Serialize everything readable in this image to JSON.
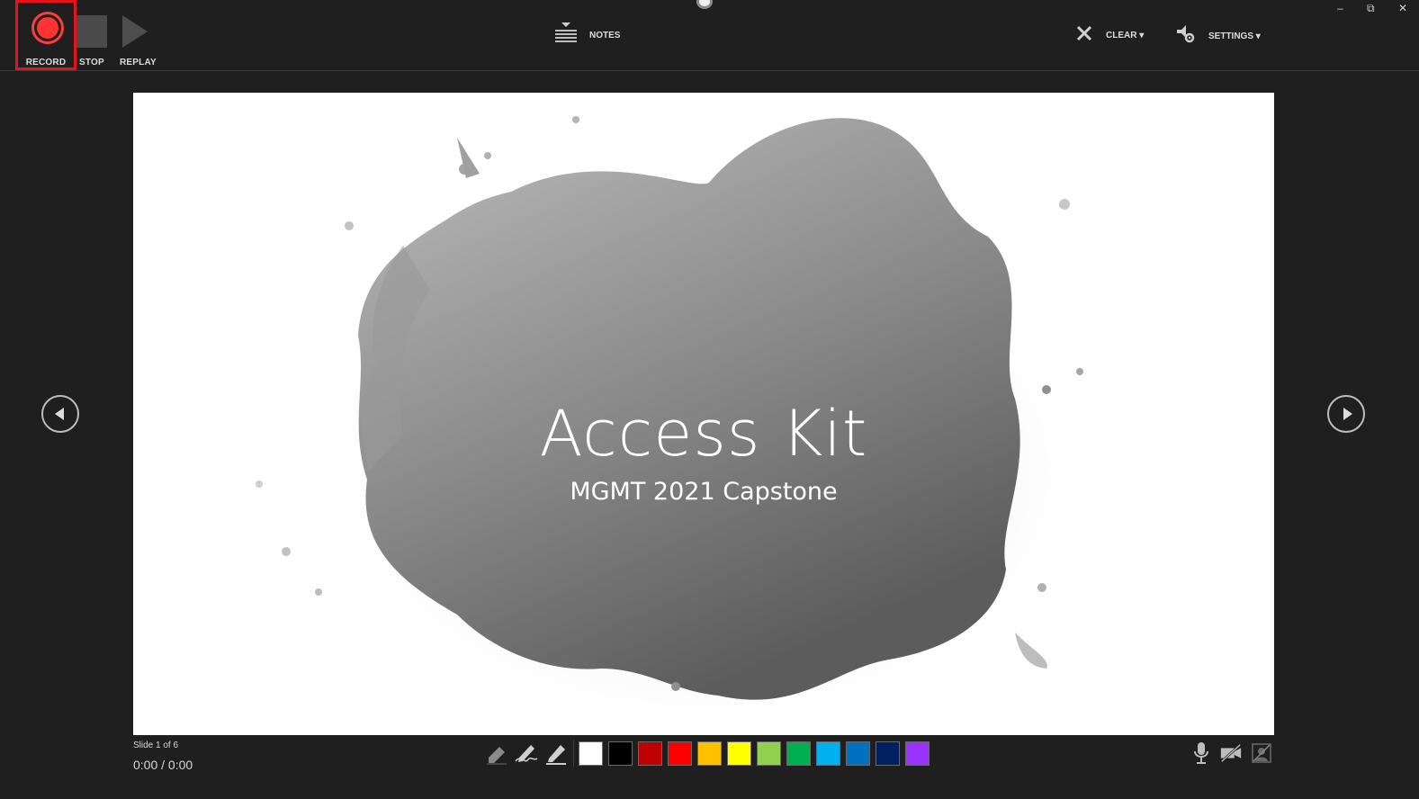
{
  "toolbar": {
    "record_label": "RECORD",
    "stop_label": "STOP",
    "replay_label": "REPLAY",
    "notes_label": "NOTES",
    "clear_label": "CLEAR ▾",
    "settings_label": "SETTINGS ▾",
    "icons": [
      "record-icon",
      "stop-icon",
      "replay-icon",
      "notes-icon",
      "clear-x-icon",
      "settings-icon"
    ]
  },
  "window_controls": {
    "minimize": "–",
    "restore": "⧉",
    "close": "✕"
  },
  "slide": {
    "title": "Access Kit",
    "subtitle": "MGMT 2021 Capstone"
  },
  "status": {
    "slide_count": "Slide 1 of 6",
    "timer": "0:00 / 0:00"
  },
  "ink_tools": [
    "eraser-icon",
    "pen-icon",
    "highlighter-icon"
  ],
  "colors": [
    "#ffffff",
    "#000000",
    "#c00000",
    "#ff0000",
    "#ffc000",
    "#ffff00",
    "#92d050",
    "#00b050",
    "#00b0f0",
    "#0070c0",
    "#002060",
    "#9933ff"
  ],
  "media_icons": [
    "microphone-icon",
    "camera-off-icon",
    "camera-preview-off-icon"
  ]
}
